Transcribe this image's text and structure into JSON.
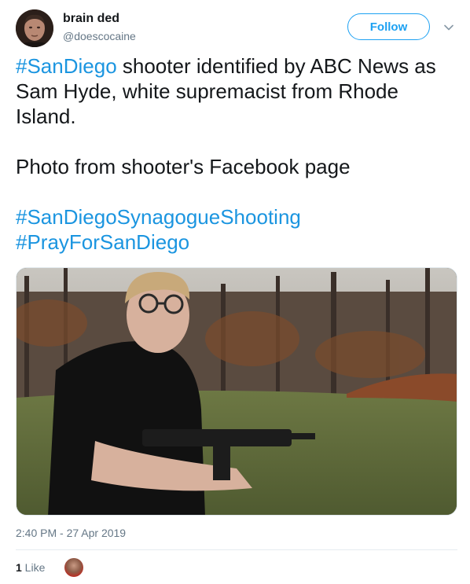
{
  "author": {
    "display_name": "brain ded",
    "handle": "@doescocaine",
    "avatar_icon": "user-avatar"
  },
  "follow_label": "Follow",
  "caret_icon": "chevron-down-icon",
  "tweet": {
    "hashtag_1": "#SanDiego",
    "line_1_rest": " shooter identified by ABC News as Sam Hyde, white supremacist from Rhode Island.",
    "line_2": "Photo from shooter's Facebook page",
    "hashtag_2": "#SanDiegoSynagogueShooting",
    "hashtag_3": "#PrayForSanDiego"
  },
  "timestamp": "2:40 PM - 27 Apr 2019",
  "likes": {
    "count": "1",
    "label": " Like"
  },
  "colors": {
    "link": "#1b95e0",
    "follow": "#1da1f2",
    "muted": "#657786",
    "text": "#14171a"
  }
}
